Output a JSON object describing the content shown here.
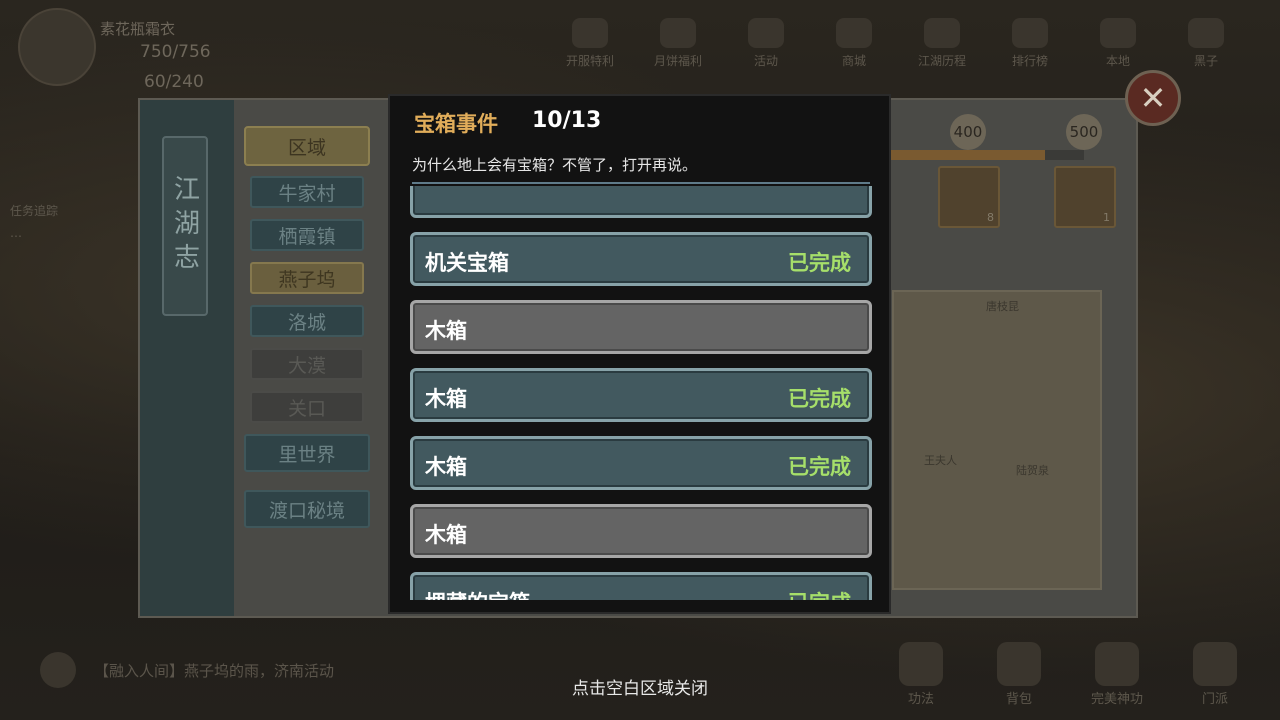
{
  "hud": {
    "player_name": "素花瓶霜衣",
    "hp": "750/756",
    "mp": "60/240",
    "top_menu": [
      "开服特利",
      "月饼福利",
      "活动",
      "商城",
      "江湖历程",
      "排行榜",
      "本地",
      "黑子"
    ]
  },
  "quest_panel": {
    "lines": [
      "任务追踪",
      "…"
    ]
  },
  "chat": {
    "message": "【融入人间】燕子坞的雨，济南活动"
  },
  "bottom_menu": [
    "功法",
    "背包",
    "完美神功",
    "门派"
  ],
  "chronicle": {
    "title": "江湖志",
    "region_header": "区域",
    "regions": [
      {
        "label": "牛家村",
        "state": "normal"
      },
      {
        "label": "栖霞镇",
        "state": "normal"
      },
      {
        "label": "燕子坞",
        "state": "selected"
      },
      {
        "label": "洛城",
        "state": "normal"
      },
      {
        "label": "大漠",
        "state": "locked"
      },
      {
        "label": "关口",
        "state": "locked"
      }
    ],
    "extra_regions": [
      "里世界",
      "渡口秘境"
    ],
    "milestones": [
      "400",
      "500"
    ],
    "progress_fraction": 0.8,
    "rewards": [
      {
        "count": "8"
      },
      {
        "count": "1"
      }
    ],
    "map_labels": [
      "唐枝昆",
      "王夫人",
      "陆贺泉"
    ]
  },
  "popup": {
    "title": "宝箱事件",
    "count": "10/13",
    "description": "为什么地上会有宝箱？不管了，打开再说。",
    "events": [
      {
        "name": "",
        "status": "",
        "done": true
      },
      {
        "name": "机关宝箱",
        "status": "已完成",
        "done": true
      },
      {
        "name": "木箱",
        "status": "",
        "done": false
      },
      {
        "name": "木箱",
        "status": "已完成",
        "done": true
      },
      {
        "name": "木箱",
        "status": "已完成",
        "done": true
      },
      {
        "name": "木箱",
        "status": "",
        "done": false
      },
      {
        "name": "埋藏的宝箱",
        "status": "已完成",
        "done": true
      }
    ]
  },
  "close_hint": "点击空白区域关闭",
  "colors": {
    "title_gold": "#e1ad5a",
    "done_green": "#a6df6a",
    "row_done": "#42595f",
    "row_pending": "#646464"
  }
}
